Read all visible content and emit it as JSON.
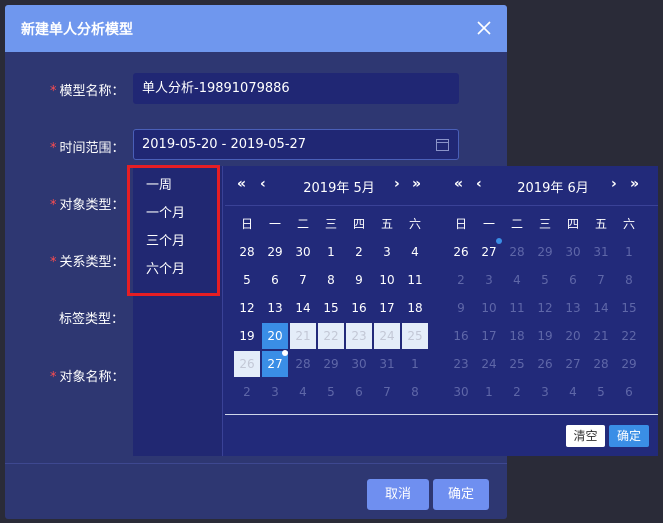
{
  "dialog": {
    "title": "新建单人分析模型",
    "cancel_label": "取消",
    "ok_label": "确定"
  },
  "form": {
    "model_name_label": "模型名称：",
    "model_name_value": "单人分析-19891079886",
    "time_range_label": "时间范围：",
    "time_range_value": "2019-05-20 - 2019-05-27",
    "object_type_label": "对象类型：",
    "relation_type_label": "关系类型：",
    "tag_type_label": "标签类型：",
    "object_name_label": "对象名称："
  },
  "picker": {
    "shortcuts": [
      "一周",
      "一个月",
      "三个月",
      "六个月"
    ],
    "left_title": "2019年 5月",
    "right_title": "2019年 6月",
    "weekdays": [
      "日",
      "一",
      "二",
      "三",
      "四",
      "五",
      "六"
    ],
    "left_days": [
      [
        "28",
        "29",
        "30",
        "1",
        "2",
        "3",
        "4"
      ],
      [
        "5",
        "6",
        "7",
        "8",
        "9",
        "10",
        "11"
      ],
      [
        "12",
        "13",
        "14",
        "15",
        "16",
        "17",
        "18"
      ],
      [
        "19",
        "20",
        "21",
        "22",
        "23",
        "24",
        "25"
      ],
      [
        "26",
        "27",
        "28",
        "29",
        "30",
        "31",
        "1"
      ],
      [
        "2",
        "3",
        "4",
        "5",
        "6",
        "7",
        "8"
      ]
    ],
    "right_days": [
      [
        "26",
        "27",
        "28",
        "29",
        "30",
        "31",
        "1"
      ],
      [
        "2",
        "3",
        "4",
        "5",
        "6",
        "7",
        "8"
      ],
      [
        "9",
        "10",
        "11",
        "12",
        "13",
        "14",
        "15"
      ],
      [
        "16",
        "17",
        "18",
        "19",
        "20",
        "21",
        "22"
      ],
      [
        "23",
        "24",
        "25",
        "26",
        "27",
        "28",
        "29"
      ],
      [
        "30",
        "1",
        "2",
        "3",
        "4",
        "5",
        "6"
      ]
    ],
    "clear_label": "清空",
    "ok_label": "确定",
    "nav": {
      "prev_year": "«",
      "prev_month": "‹",
      "next_month": "›",
      "next_year": "»"
    }
  }
}
